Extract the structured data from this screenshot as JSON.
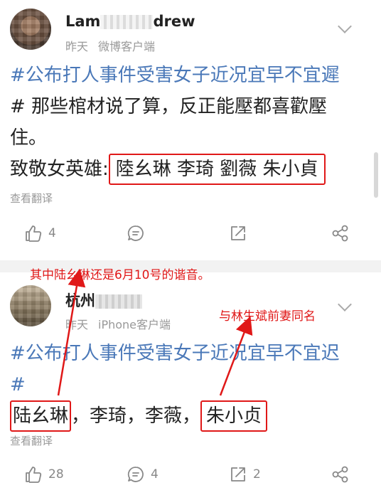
{
  "posts": [
    {
      "username_start": "Lam",
      "username_end": "drew",
      "time": "昨天",
      "source": "微博客户端",
      "line1": "#公布打人事件受害女子近况宜早不宜遲",
      "line2": "# 那些棺材说了算，反正能壓都喜歡壓",
      "line3": "住。",
      "line4_prefix": "致敬女英雄:",
      "line4_boxed": "陸幺琳 李琦 劉薇 朱小貞",
      "translate": "查看翻译",
      "likes": "4",
      "comments": "",
      "reposts": ""
    },
    {
      "username_start": "杭州",
      "username_end": "",
      "time": "昨天",
      "source": "iPhone客户端",
      "line1": "#公布打人事件受害女子近况宜早不宜迟",
      "line2": "#",
      "name1": "陆幺琳",
      "sep1": "，李琦，李薇，",
      "name4": "朱小贞",
      "translate": "查看翻译",
      "likes": "28",
      "comments": "4",
      "reposts": "2"
    }
  ],
  "annotations": {
    "note1": "其中陆幺琳还是6月10号的谐音。",
    "note2": "与林生斌前妻同名"
  },
  "colors": {
    "accent_red": "#e01818",
    "hashtag_blue": "#4a78b8",
    "icon_gray": "#888888"
  }
}
